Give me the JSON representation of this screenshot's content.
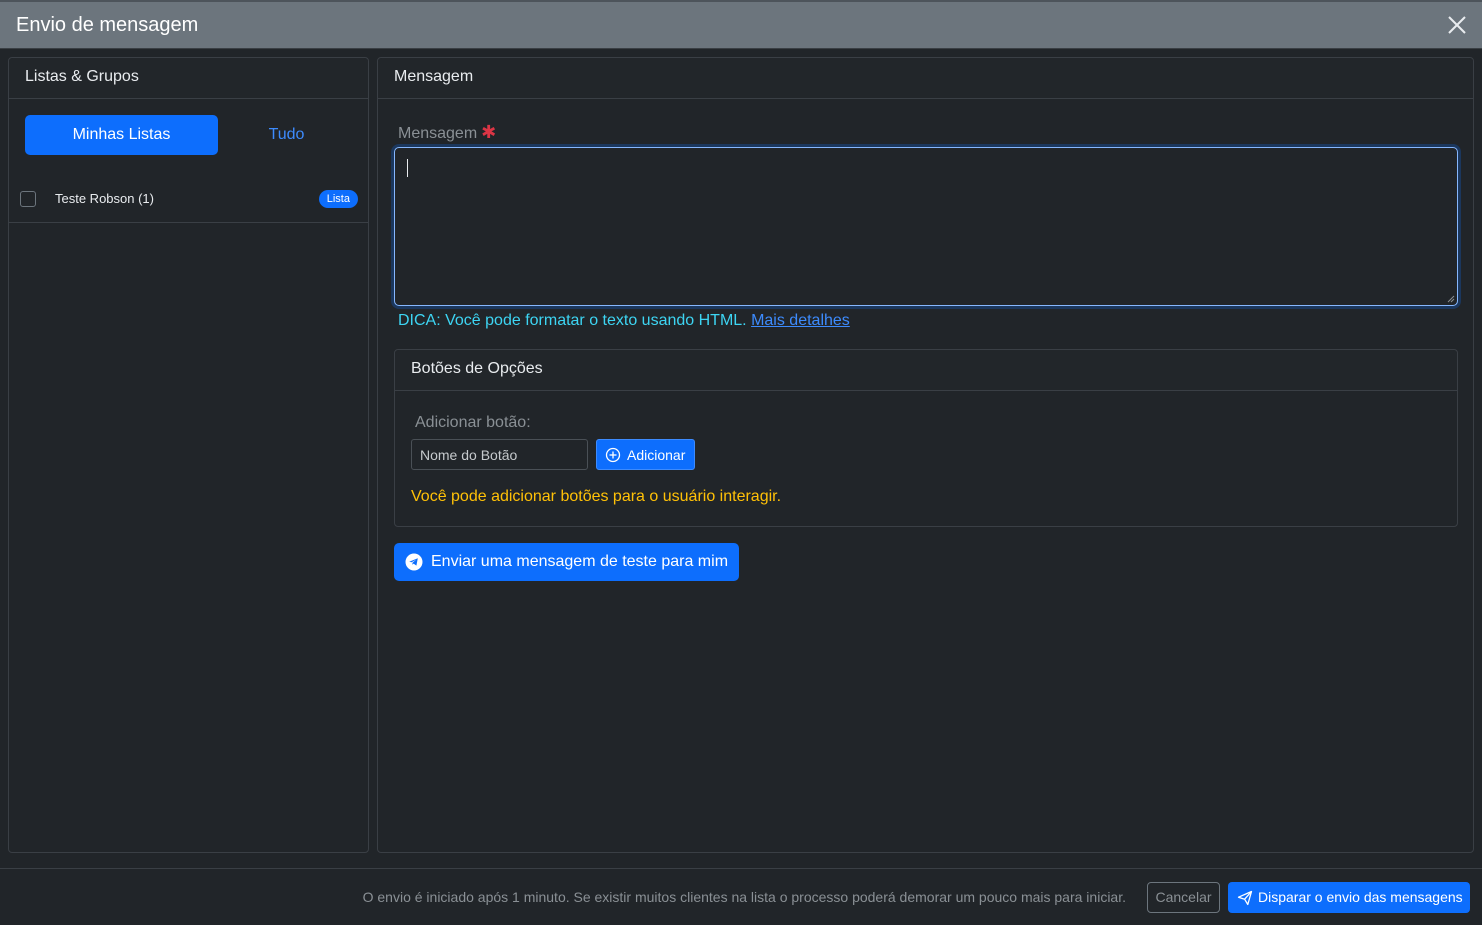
{
  "modal": {
    "title": "Envio de mensagem"
  },
  "left_panel": {
    "header": "Listas & Grupos",
    "tabs": [
      {
        "label": "Minhas Listas",
        "active": true
      },
      {
        "label": "Tudo",
        "active": false
      }
    ],
    "items": [
      {
        "name": "Teste Robson (1)",
        "badge": "Lista",
        "checked": false
      }
    ]
  },
  "right_panel": {
    "header": "Mensagem",
    "message_label": "Mensagem",
    "required_marker": "✱",
    "message_value": "",
    "hint_text": "DICA: Você pode formatar o texto usando HTML.",
    "hint_link": "Mais detalhes",
    "buttons_card": {
      "header": "Botões de Opções",
      "add_label": "Adicionar botão:",
      "input_placeholder": "Nome do Botão",
      "add_button": "Adicionar",
      "warning": "Você pode adicionar botões para o usuário interagir."
    },
    "send_test_button": "Enviar uma mensagem de teste para mim"
  },
  "footer": {
    "note": "O envio é iniciado após 1 minuto. Se existir muitos clientes na lista o processo poderá demorar um pouco mais para iniciar.",
    "cancel": "Cancelar",
    "submit": "Disparar o envio das mensagens"
  },
  "colors": {
    "primary": "#0d6efd",
    "background": "#212529",
    "header_bar": "#6c757d",
    "hint": "#3dd5f3",
    "warning": "#ffc107",
    "required": "#dc3545"
  },
  "icons": {
    "close": "close-icon",
    "add": "plus-circle-icon",
    "telegram": "telegram-icon",
    "send": "send-icon"
  }
}
